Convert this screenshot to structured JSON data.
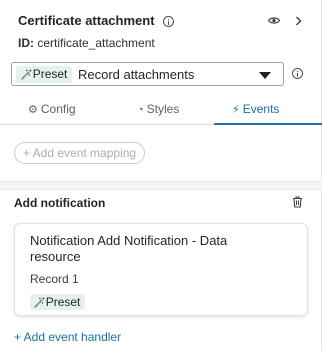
{
  "header": {
    "title": "Certificate attachment",
    "id_label": "ID:",
    "id_value": "certificate_attachment"
  },
  "preset_select": {
    "badge_icon": "wand-icon",
    "badge_label": "Preset",
    "value": "Record attachments"
  },
  "tabs": [
    {
      "label": "Config",
      "icon": "gear-icon"
    },
    {
      "label": "Styles",
      "icon": "palette-icon"
    },
    {
      "label": "Events",
      "icon": "lightning-icon"
    }
  ],
  "events": {
    "add_mapping_label": "+ Add event mapping",
    "section_title": "Add notification",
    "card": {
      "title": "Notification Add Notification - Data resource",
      "subtitle": "Record 1",
      "badge_label": "Preset"
    },
    "add_handler_label": "+ Add event handler"
  },
  "colors": {
    "accent": "#1d6fa5",
    "badge_bg": "#e5f1ec",
    "border": "#9aa2ab"
  }
}
